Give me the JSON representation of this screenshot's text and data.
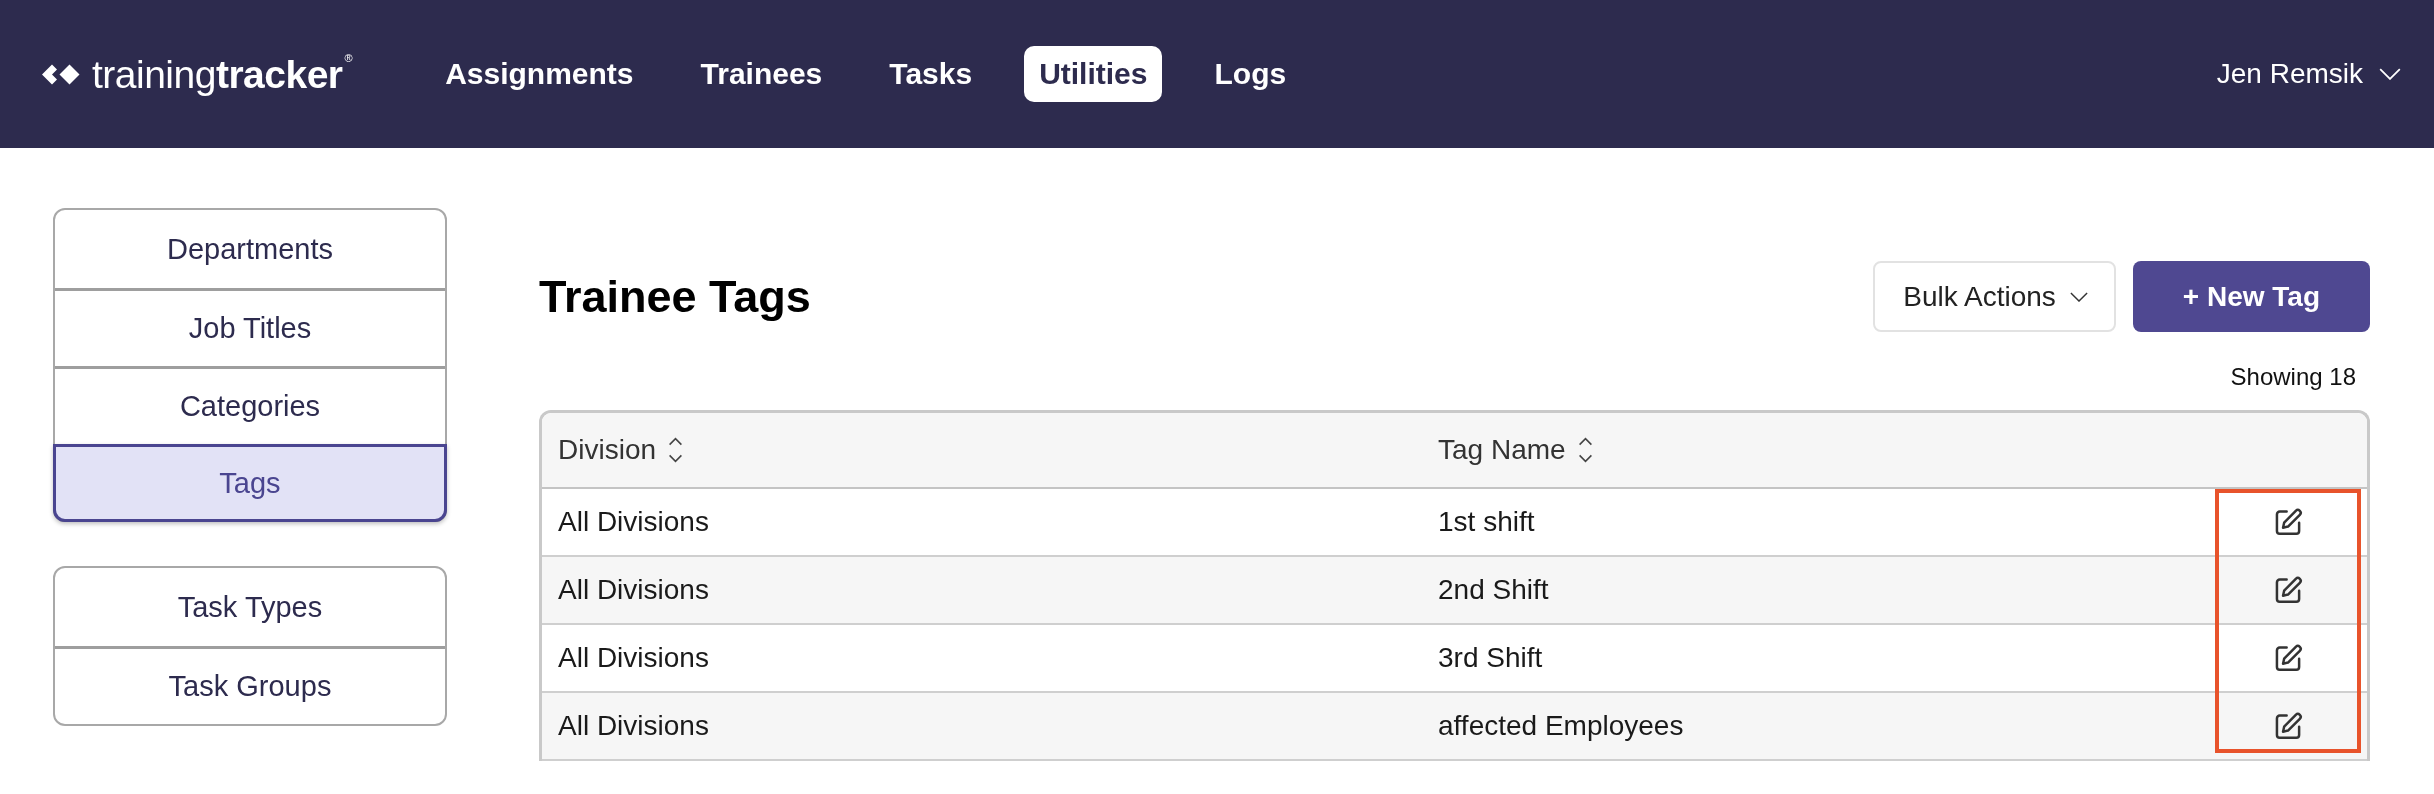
{
  "nav": {
    "logo": "training**tracker**$^{®}$",
    "items": [
      {
        "label": "Assignments",
        "selected": false
      },
      {
        "label": "Trainees",
        "selected": false
      },
      {
        "label": "Tasks",
        "selected": false
      },
      {
        "label": "Utilities",
        "selected": true
      },
      {
        "label": "Logs",
        "selected": false
      }
    ],
    "user": "Jen Remsik"
  },
  "sidebar": {
    "groups": [
      {
        "items": [
          {
            "label": "Departments",
            "selected": false
          },
          {
            "label": "Job Titles",
            "selected": false
          },
          {
            "label": "Categories",
            "selected": false
          },
          {
            "label": "Tags",
            "selected": true
          }
        ]
      },
      {
        "items": [
          {
            "label": "Task Types",
            "selected": false
          },
          {
            "label": "Task Groups",
            "selected": false
          }
        ]
      }
    ]
  },
  "main": {
    "title": "Trainee Tags",
    "actions": [
      {
        "kind": "dropdown",
        "label": "Bulk Actions"
      },
      {
        "kind": "primary",
        "label": "+ New Tag"
      }
    ],
    "count": "Showing 18"
  },
  "table": {
    "columns": [
      {
        "label": "Division",
        "sortable": true
      },
      {
        "label": "Tag Name",
        "sortable": true
      }
    ],
    "rows": [
      {
        "cells": [
          "All Divisions",
          "1st shift"
        ]
      },
      {
        "cells": [
          "All Divisions",
          "2nd Shift"
        ]
      },
      {
        "cells": [
          "All Divisions",
          "3rd Shift"
        ]
      },
      {
        "cells": [
          "All Divisions",
          "affected Employees"
        ]
      }
    ],
    "edit_column_highlighted": true
  }
}
